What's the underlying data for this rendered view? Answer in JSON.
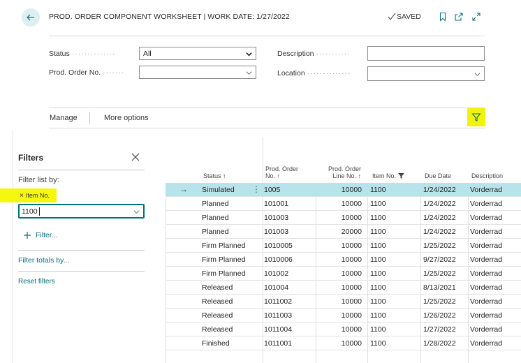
{
  "header": {
    "title": "PROD. ORDER COMPONENT WORKSHEET | WORK DATE: 1/27/2022",
    "saved_label": "SAVED"
  },
  "fields": {
    "status_label": "Status",
    "status_value": "All",
    "prod_order_no_label": "Prod. Order No.",
    "prod_order_no_value": "",
    "description_label": "Description",
    "description_value": "",
    "location_label": "Location",
    "location_value": ""
  },
  "actions": {
    "manage": "Manage",
    "more_options": "More options"
  },
  "filter_pane": {
    "title": "Filters",
    "filter_list_by": "Filter list by:",
    "chip_label": "Item No.",
    "item_no_value": "1100",
    "add_filter": "Filter...",
    "filter_totals_by": "Filter totals by...",
    "reset_filters": "Reset filters"
  },
  "table": {
    "columns": {
      "status": "Status",
      "prod_order_no_1": "Prod. Order",
      "prod_order_no_2": "No.",
      "line_no_1": "Prod. Order",
      "line_no_2": "Line No.",
      "item_no": "Item No.",
      "due_date": "Due Date",
      "description": "Description"
    },
    "rows": [
      {
        "status": "Simulated",
        "prod_order_no": "1005",
        "line_no": "10000",
        "item_no": "1100",
        "due_date": "1/24/2022",
        "description": "Vorderrad"
      },
      {
        "status": "Planned",
        "prod_order_no": "101001",
        "line_no": "10000",
        "item_no": "1100",
        "due_date": "1/24/2022",
        "description": "Vorderrad"
      },
      {
        "status": "Planned",
        "prod_order_no": "101003",
        "line_no": "10000",
        "item_no": "1100",
        "due_date": "1/24/2022",
        "description": "Vorderrad"
      },
      {
        "status": "Planned",
        "prod_order_no": "101003",
        "line_no": "20000",
        "item_no": "1100",
        "due_date": "1/24/2022",
        "description": "Vorderrad"
      },
      {
        "status": "Firm Planned",
        "prod_order_no": "1010005",
        "line_no": "10000",
        "item_no": "1100",
        "due_date": "1/25/2022",
        "description": "Vorderrad"
      },
      {
        "status": "Firm Planned",
        "prod_order_no": "1010006",
        "line_no": "10000",
        "item_no": "1100",
        "due_date": "9/27/2022",
        "description": "Vorderrad"
      },
      {
        "status": "Firm Planned",
        "prod_order_no": "101002",
        "line_no": "10000",
        "item_no": "1100",
        "due_date": "1/25/2022",
        "description": "Vorderrad"
      },
      {
        "status": "Released",
        "prod_order_no": "101004",
        "line_no": "10000",
        "item_no": "1100",
        "due_date": "8/13/2021",
        "description": "Vorderrad"
      },
      {
        "status": "Released",
        "prod_order_no": "1011002",
        "line_no": "10000",
        "item_no": "1100",
        "due_date": "1/25/2022",
        "description": "Vorderrad"
      },
      {
        "status": "Released",
        "prod_order_no": "1011003",
        "line_no": "10000",
        "item_no": "1100",
        "due_date": "1/26/2022",
        "description": "Vorderrad"
      },
      {
        "status": "Released",
        "prod_order_no": "1011004",
        "line_no": "10000",
        "item_no": "1100",
        "due_date": "1/27/2022",
        "description": "Vorderrad"
      },
      {
        "status": "Finished",
        "prod_order_no": "1011001",
        "line_no": "10000",
        "item_no": "1100",
        "due_date": "1/28/2022",
        "description": "Vorderrad"
      }
    ]
  },
  "colors": {
    "accent": "#00707a",
    "highlight": "#f1f40a",
    "selected_row": "#b7e4ea"
  }
}
